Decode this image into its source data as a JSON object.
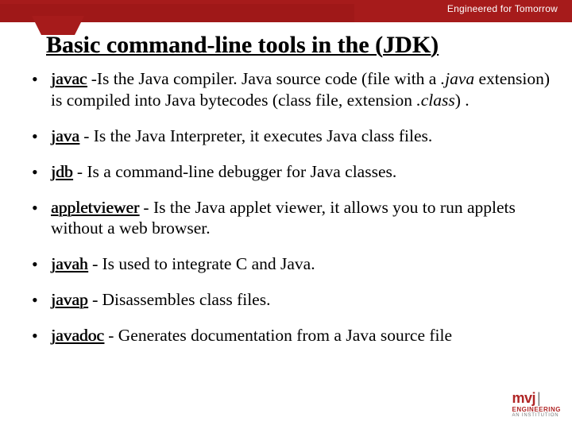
{
  "header": {
    "tagline": "Engineered for Tomorrow",
    "title": "Basic command-line tools in the (JDK)"
  },
  "items": [
    {
      "tool": "javac",
      "desc_html": " -Is the Java compiler. Java source code (file with a <span class='emf'>.java</span> extension) is compiled into Java bytecodes (class file, extension <span class='emf'>.class</span>) ."
    },
    {
      "tool": "java",
      "desc_html": " - Is the Java Interpreter, it executes Java class files."
    },
    {
      "tool": "jdb",
      "desc_html": " - Is a command-line debugger for Java classes."
    },
    {
      "tool": "appletviewer",
      "desc_html": " - Is the Java applet viewer, it allows you to run applets without a web browser."
    },
    {
      "tool": "javah",
      "desc_html": "<span class='ds'> - </span>Is used to integrate C and Java."
    },
    {
      "tool": "javap",
      "desc_html": "<span class='ds'> - </span>Disassembles class files."
    },
    {
      "tool": "javadoc",
      "desc_html": " - Generates documentation from a Java source file"
    }
  ],
  "logo": {
    "main": "mvj",
    "sub1": "ENGINEERING",
    "sub2": "AN INSTITUTION"
  }
}
